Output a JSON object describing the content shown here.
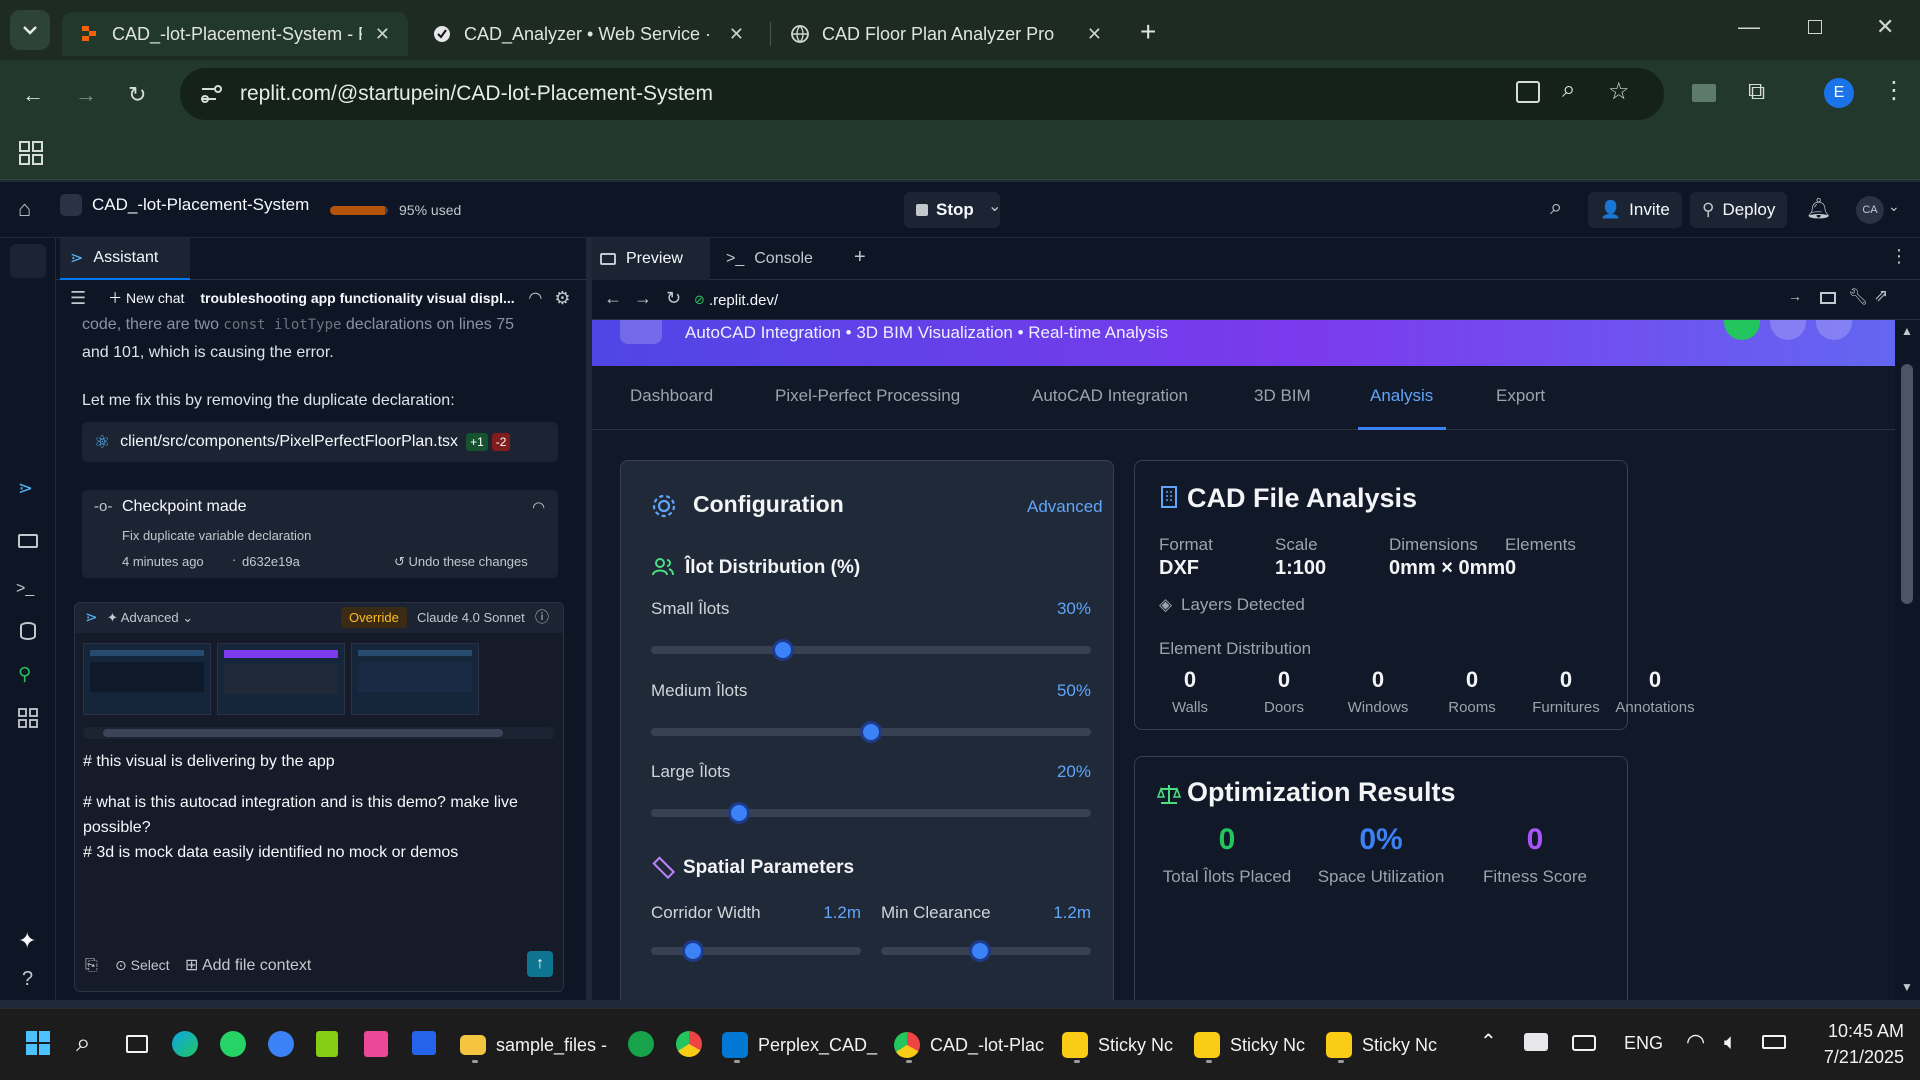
{
  "browser": {
    "tabs": [
      {
        "title": "CAD_-lot-Placement-System - R",
        "active": true
      },
      {
        "title": "CAD_Analyzer • Web Service ·",
        "active": false
      },
      {
        "title": "CAD Floor Plan Analyzer Pro",
        "active": false
      }
    ],
    "url": "replit.com/@startupein/CAD-lot-Placement-System",
    "profile_initial": "E"
  },
  "replit": {
    "project_name": "CAD_-lot-Placement-System",
    "usage_text": "95% used",
    "usage_fraction": 0.95,
    "stop_label": "Stop",
    "invite_label": "Invite",
    "deploy_label": "Deploy",
    "avatar_initials": "CA"
  },
  "assistant": {
    "tab_label": "Assistant",
    "new_chat_label": "New chat",
    "chat_title": "troubleshooting app functionality visual displ...",
    "msg_line1_a": "code, there are two",
    "msg_line1_code": "const ilotType",
    "msg_line1_b": "declarations on lines 75",
    "msg_line2": "and 101, which is causing the error.",
    "msg_line3": "Let me fix this by removing the duplicate declaration:",
    "file_change": {
      "path": "client/src/components/PixelPerfectFloorPlan.tsx",
      "added": "+1",
      "removed": "-2"
    },
    "checkpoint": {
      "title": "Checkpoint made",
      "desc": "Fix duplicate variable declaration",
      "time": "4 minutes ago",
      "hash": "d632e19a",
      "undo_label": "Undo these changes"
    },
    "input": {
      "advanced_label": "Advanced",
      "override_label": "Override",
      "model_label": "Claude 4.0 Sonnet",
      "line1": "# this visual is delivering by the app",
      "line2": "# what is this autocad integration and is this demo? make live possible?",
      "line3": "# 3d is mock data easily identified no mock or demos",
      "select_label": "Select",
      "add_file_label": "Add file context"
    }
  },
  "preview": {
    "tab_preview": "Preview",
    "tab_console": "Console",
    "url": ".replit.dev/",
    "banner_subtitle": "AutoCAD Integration • 3D BIM Visualization • Real-time Analysis",
    "tabs": [
      "Dashboard",
      "Pixel-Perfect Processing",
      "AutoCAD Integration",
      "3D BIM",
      "Analysis",
      "Export"
    ],
    "config": {
      "title": "Configuration",
      "advanced_link": "Advanced",
      "distribution_title": "Îlot Distribution (%)",
      "sliders": [
        {
          "label": "Small Îlots",
          "value": "30%",
          "fraction": 0.3
        },
        {
          "label": "Medium Îlots",
          "value": "50%",
          "fraction": 0.5
        },
        {
          "label": "Large Îlots",
          "value": "20%",
          "fraction": 0.2
        }
      ],
      "spatial_title": "Spatial Parameters",
      "corridor": {
        "label": "Corridor Width",
        "value": "1.2m",
        "fraction": 0.2
      },
      "clearance": {
        "label": "Min Clearance",
        "value": "1.2m",
        "fraction": 0.47
      }
    },
    "analysis": {
      "title": "CAD File Analysis",
      "meta": [
        {
          "label": "Format",
          "value": "DXF"
        },
        {
          "label": "Scale",
          "value": "1:100"
        },
        {
          "label": "Dimensions",
          "value": "0mm × 0mm"
        },
        {
          "label": "Elements",
          "value": "0"
        }
      ],
      "layers_label": "Layers Detected",
      "distribution_label": "Element Distribution",
      "stats": [
        {
          "value": "0",
          "label": "Walls"
        },
        {
          "value": "0",
          "label": "Doors"
        },
        {
          "value": "0",
          "label": "Windows"
        },
        {
          "value": "0",
          "label": "Rooms"
        },
        {
          "value": "0",
          "label": "Furnitures"
        },
        {
          "value": "0",
          "label": "Annotations"
        }
      ]
    },
    "optimization": {
      "title": "Optimization Results",
      "results": [
        {
          "value": "0",
          "label": "Total Îlots Placed",
          "color": "#22c55e"
        },
        {
          "value": "0%",
          "label": "Space Utilization",
          "color": "#3b82f6"
        },
        {
          "value": "0",
          "label": "Fitness Score",
          "color": "#a855f7"
        }
      ]
    }
  },
  "taskbar": {
    "items": [
      "sample_files -",
      "Perplex_CAD_",
      "CAD_-lot-Plac",
      "Sticky Nc",
      "Sticky Nc",
      "Sticky Nc"
    ],
    "language": "ENG",
    "time": "10:45 AM",
    "date": "7/21/2025"
  }
}
